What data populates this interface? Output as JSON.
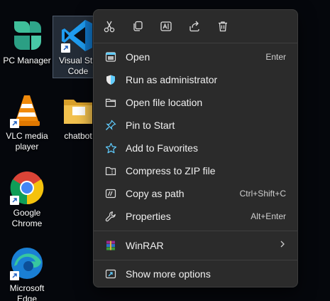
{
  "desktop": {
    "icons": [
      {
        "label": "PC Manager"
      },
      {
        "label": "Visual Studio Code",
        "line1": "Visual Stu",
        "line2": "Code"
      },
      {
        "label": "VLC media player",
        "line1": "VLC media",
        "line2": "player"
      },
      {
        "label": "chatbot"
      },
      {
        "label": "Google Chrome",
        "line1": "Google",
        "line2": "Chrome"
      },
      {
        "label": "Microsoft Edge",
        "line1": "Microsoft",
        "line2": "Edge"
      }
    ]
  },
  "menu": {
    "toolbar": [
      {
        "icon": "scissors-icon",
        "name": "cut"
      },
      {
        "icon": "copy-icon",
        "name": "copy"
      },
      {
        "icon": "rename-icon",
        "name": "rename"
      },
      {
        "icon": "share-icon",
        "name": "share"
      },
      {
        "icon": "trash-icon",
        "name": "delete"
      }
    ],
    "items": [
      {
        "label": "Open",
        "shortcut": "Enter",
        "icon": "open-window-icon"
      },
      {
        "label": "Run as administrator",
        "shortcut": "",
        "icon": "shield-icon"
      },
      {
        "label": "Open file location",
        "shortcut": "",
        "icon": "folder-icon"
      },
      {
        "label": "Pin to Start",
        "shortcut": "",
        "icon": "pin-icon"
      },
      {
        "label": "Add to Favorites",
        "shortcut": "",
        "icon": "star-icon"
      },
      {
        "label": "Compress to ZIP file",
        "shortcut": "",
        "icon": "zip-folder-icon"
      },
      {
        "label": "Copy as path",
        "shortcut": "Ctrl+Shift+C",
        "icon": "path-icon"
      },
      {
        "label": "Properties",
        "shortcut": "Alt+Enter",
        "icon": "wrench-icon"
      }
    ],
    "winrar": {
      "label": "WinRAR",
      "icon": "winrar-icon"
    },
    "more": {
      "label": "Show more options",
      "icon": "more-options-icon"
    }
  },
  "colors": {
    "accent": "#60cdff",
    "menu_bg": "#2b2b2b",
    "separator": "#3f3f3f"
  }
}
